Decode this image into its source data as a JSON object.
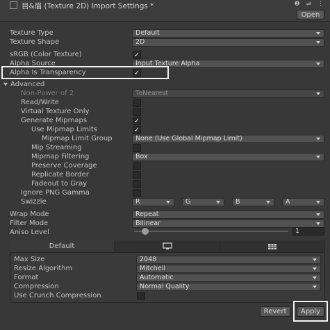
{
  "header": {
    "title": "目&眉 (Texture 2D) Import Settings *",
    "icons": "❷ ⇌ ⋮",
    "open_label": "Open"
  },
  "settings": {
    "texture_type": {
      "label": "Texture Type",
      "value": "Default"
    },
    "texture_shape": {
      "label": "Texture Shape",
      "value": "2D"
    },
    "srgb": {
      "label": "sRGB (Color Texture)",
      "checked": true
    },
    "alpha_source": {
      "label": "Alpha Source",
      "value": "Input Texture Alpha"
    },
    "alpha_is_transparency": {
      "label": "Alpha Is Transparency",
      "checked": true
    },
    "advanced_label": "Advanced",
    "non_power_of_2": {
      "label": "Non-Power of 2",
      "value": "ToNearest"
    },
    "read_write": {
      "label": "Read/Write",
      "checked": false
    },
    "virtual_texture_only": {
      "label": "Virtual Texture Only",
      "checked": false
    },
    "generate_mipmaps": {
      "label": "Generate Mipmaps",
      "checked": true
    },
    "use_mipmap_limits": {
      "label": "Use Mipmap Limits",
      "checked": true
    },
    "mipmap_limit_group": {
      "label": "Mipmap Limit Group",
      "value": "None (Use Global Mipmap Limit)"
    },
    "mip_streaming": {
      "label": "Mip Streaming",
      "checked": false
    },
    "mipmap_filtering": {
      "label": "Mipmap Filtering",
      "value": "Box"
    },
    "preserve_coverage": {
      "label": "Preserve Coverage",
      "checked": false
    },
    "replicate_border": {
      "label": "Replicate Border",
      "checked": false
    },
    "fadeout_to_gray": {
      "label": "Fadeout to Gray",
      "checked": false
    },
    "ignore_png_gamma": {
      "label": "Ignore PNG Gamma",
      "checked": false
    },
    "swizzle": {
      "label": "Swizzle",
      "values": [
        "R",
        "G",
        "B",
        "A"
      ]
    },
    "wrap_mode": {
      "label": "Wrap Mode",
      "value": "Repeat"
    },
    "filter_mode": {
      "label": "Filter Mode",
      "value": "Bilinear"
    },
    "aniso_level": {
      "label": "Aniso Level",
      "value": "1",
      "level": 1
    }
  },
  "platform": {
    "tabs": [
      "Default",
      "monitor-icon",
      "grid-icon"
    ],
    "max_size": {
      "label": "Max Size",
      "value": "2048"
    },
    "resize_algorithm": {
      "label": "Resize Algorithm",
      "value": "Mitchell"
    },
    "format": {
      "label": "Format",
      "value": "Automatic"
    },
    "compression": {
      "label": "Compression",
      "value": "Normal Quality"
    },
    "use_crunch": {
      "label": "Use Crunch Compression",
      "checked": false
    }
  },
  "footer": {
    "revert_label": "Revert",
    "apply_label": "Apply"
  }
}
